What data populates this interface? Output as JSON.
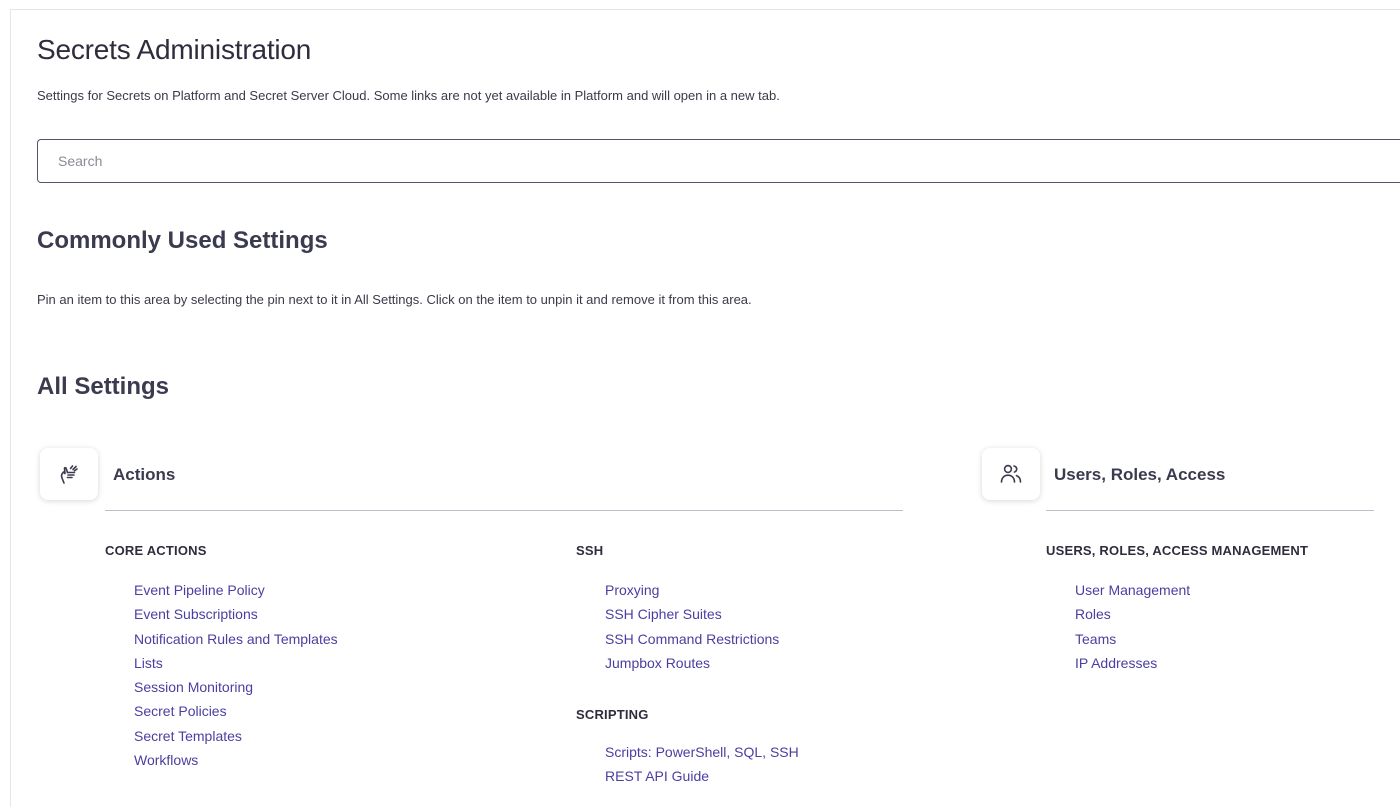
{
  "page": {
    "title": "Secrets Administration",
    "subtitle": "Settings for Secrets on Platform and Secret Server Cloud. Some links are not yet available in Platform and will open in a new tab."
  },
  "search": {
    "placeholder": "Search",
    "value": ""
  },
  "common": {
    "heading": "Commonly Used Settings",
    "note": "Pin an item to this area by selecting the pin next to it in All Settings. Click on the item to unpin it and remove it from this area."
  },
  "all": {
    "heading": "All Settings",
    "categories": [
      {
        "title": "Actions",
        "icon": "hand-pointer-icon",
        "groups": [
          {
            "heading": "CORE ACTIONS",
            "links": [
              "Event Pipeline Policy",
              "Event Subscriptions",
              "Notification Rules and Templates",
              "Lists",
              "Session Monitoring",
              "Secret Policies",
              "Secret Templates",
              "Workflows"
            ]
          },
          {
            "heading": "SSH",
            "links": [
              "Proxying",
              "SSH Cipher Suites",
              "SSH Command Restrictions",
              "Jumpbox Routes"
            ]
          },
          {
            "heading": "SCRIPTING",
            "links": [
              "Scripts: PowerShell, SQL, SSH",
              "REST API Guide"
            ]
          }
        ]
      },
      {
        "title": "Users, Roles, Access",
        "icon": "users-icon",
        "groups": [
          {
            "heading": "USERS, ROLES, ACCESS MANAGEMENT",
            "links": [
              "User Management",
              "Roles",
              "Teams",
              "IP Addresses"
            ]
          }
        ]
      }
    ]
  },
  "colors": {
    "link": "#4a3fa0",
    "heading": "#3b3b4f",
    "text": "#2e2d3d"
  }
}
